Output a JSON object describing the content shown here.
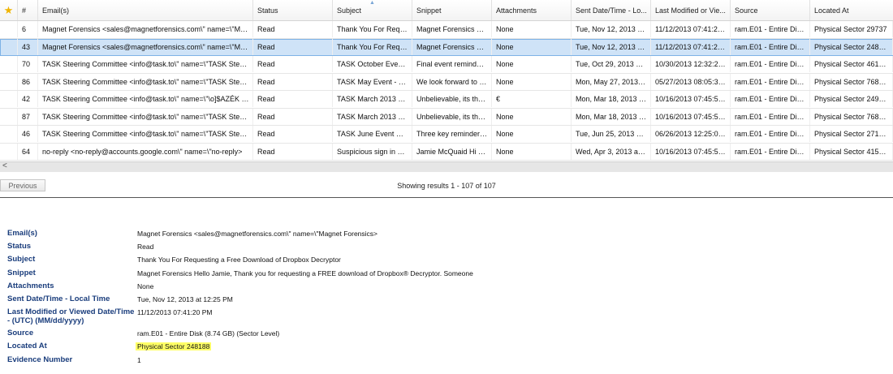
{
  "grid": {
    "columns": [
      "#",
      "Email(s)",
      "Status",
      "Subject",
      "Snippet",
      "Attachments",
      "Sent Date/Time - Lo...",
      "Last Modified or Vie...",
      "Source",
      "Located At"
    ],
    "rows": [
      {
        "num": "6",
        "email": "Magnet Forensics <sales@magnetforensics.com\\\" name=\\\"Magnet ...",
        "status": "Read",
        "subject": "Thank You For Reque...",
        "snippet": "Magnet Forensics Hell...",
        "attach": "None",
        "sent": "Tue, Nov 12, 2013 at ...",
        "modified": "11/12/2013 07:41:20 ...",
        "source": "ram.E01 - Entire Disk (...",
        "located": "Physical Sector 29737",
        "selected": false
      },
      {
        "num": "43",
        "email": "Magnet Forensics <sales@magnetforensics.com\\\" name=\\\"Magnet ...",
        "status": "Read",
        "subject": "Thank You For Reque...",
        "snippet": "Magnet Forensics Hell...",
        "attach": "None",
        "sent": "Tue, Nov 12, 2013 at ...",
        "modified": "11/12/2013 07:41:20 ...",
        "source": "ram.E01 - Entire Disk (...",
        "located": "Physical Sector 248188",
        "selected": true
      },
      {
        "num": "70",
        "email": "TASK Steering Committee <info@task.to\\\" name=\\\"TASK Steering ...",
        "status": "Read",
        "subject": "TASK October Event ...",
        "snippet": "Final event reminder fo...",
        "attach": "None",
        "sent": "Tue, Oct 29, 2013 at ...",
        "modified": "10/30/2013 12:32:25 ...",
        "source": "ram.E01 - Entire Disk (...",
        "located": "Physical Sector 461890",
        "selected": false
      },
      {
        "num": "86",
        "email": "TASK Steering Committee <info@task.to\\\" name=\\\"TASK Steering ...",
        "status": "Read",
        "subject": "TASK May Event - W...",
        "snippet": "We look forward to se...",
        "attach": "None",
        "sent": "Mon, May 27, 2013 at ...",
        "modified": "05/27/2013 08:05:30 ...",
        "source": "ram.E01 - Entire Disk (...",
        "located": "Physical Sector 768010",
        "selected": false
      },
      {
        "num": "42",
        "email": "TASK Steering Committee <info@task.to\\\" name=\\\"\\o]$AZÉK Steerin...",
        "status": "Read",
        "subject": "TASK March 2013 Ev...",
        "snippet": "Unbelievable, its the m...",
        "attach": "€",
        "sent": "Mon, Mar 18, 2013 at ...",
        "modified": "10/16/2013 07:45:58 ...",
        "source": "ram.E01 - Entire Disk (...",
        "located": "Physical Sector 249289",
        "selected": false
      },
      {
        "num": "87",
        "email": "TASK Steering Committee <info@task.to\\\" name=\\\"TASK Steering ...",
        "status": "Read",
        "subject": "TASK March 2013 Ev...",
        "snippet": "Unbelievable, its the m...",
        "attach": "None",
        "sent": "Mon, Mar 18, 2013 at ...",
        "modified": "10/16/2013 07:45:58 ...",
        "source": "ram.E01 - Entire Disk (...",
        "located": "Physical Sector 768010",
        "selected": false
      },
      {
        "num": "46",
        "email": "TASK Steering Committee <info@task.to\\\" name=\\\"TASK Steering ...",
        "status": "Read",
        "subject": "TASK June Event Re...",
        "snippet": "Three key reminders: - ...",
        "attach": "None",
        "sent": "Tue, Jun 25, 2013 at ...",
        "modified": "06/26/2013 12:25:08 ...",
        "source": "ram.E01 - Entire Disk (...",
        "located": "Physical Sector 271962",
        "selected": false
      },
      {
        "num": "64",
        "email": "no-reply <no-reply@accounts.google.com\\\" name=\\\"no-reply>",
        "status": "Read",
        "subject": "Suspicious sign in pre...",
        "snippet": "Jamie McQuaid Hi Ja...",
        "attach": "None",
        "sent": "Wed, Apr 3, 2013 at 1...",
        "modified": "10/16/2013 07:45:58 ...",
        "source": "ram.E01 - Entire Disk (...",
        "located": "Physical Sector 415395",
        "selected": false
      }
    ]
  },
  "pager": {
    "previous_label": "Previous",
    "showing_text": "Showing results 1 - 107 of 107"
  },
  "details": [
    {
      "label": "Email(s)",
      "value": "Magnet Forensics <sales@magnetforensics.com\\\" name=\\\"Magnet Forensics>"
    },
    {
      "label": "Status",
      "value": "Read"
    },
    {
      "label": "Subject",
      "value": "Thank You For Requesting a Free Download of Dropbox Decryptor"
    },
    {
      "label": "Snippet",
      "value": "Magnet Forensics Hello Jamie, Thank you for requesting a FREE download of Dropbox® Decryptor. Someone"
    },
    {
      "label": "Attachments",
      "value": "None"
    },
    {
      "label": "Sent Date/Time - Local Time",
      "value": "Tue, Nov 12, 2013 at 12:25 PM"
    },
    {
      "label": "Last Modified or Viewed Date/Time - (UTC) (MM/dd/yyyy)",
      "value": "11/12/2013 07:41:20 PM"
    },
    {
      "label": "Source",
      "value": "ram.E01 - Entire Disk (8.74 GB) (Sector Level)"
    },
    {
      "label": "Located At",
      "value": "Physical Sector 248188"
    },
    {
      "label": "Evidence Number",
      "value": "1"
    }
  ],
  "colors": {
    "selected_row": "#cfe3f7",
    "highlight": "#ffff66",
    "label": "#1a3d7c",
    "star": "#f0b400"
  }
}
